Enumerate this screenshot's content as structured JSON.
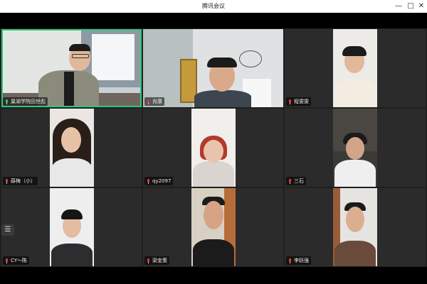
{
  "window": {
    "title": "腾讯会议",
    "min_glyph": "—",
    "max_glyph": "□",
    "close_glyph": "✕"
  },
  "sidebar_toggle_glyph": "☰",
  "participants": [
    {
      "name": "巢湖学院田世彪",
      "mic_on": true
    },
    {
      "name": "肖康",
      "mic_on": false
    },
    {
      "name": "程雯雯",
      "mic_on": false
    },
    {
      "name": "薛梅（小）",
      "mic_on": false
    },
    {
      "name": "qy2097",
      "mic_on": false
    },
    {
      "name": "三石",
      "mic_on": false
    },
    {
      "name": "CY～陈",
      "mic_on": false
    },
    {
      "name": "梁金策",
      "mic_on": false
    },
    {
      "name": "李跃强",
      "mic_on": false
    }
  ]
}
